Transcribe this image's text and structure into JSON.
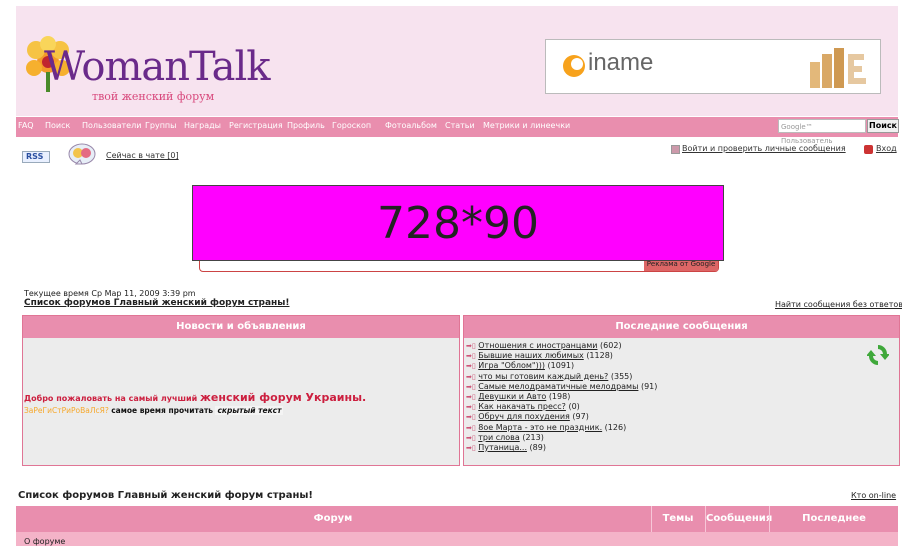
{
  "header": {
    "logo_title": "WomanTalk",
    "logo_subtitle": "твой женский форум",
    "partner_banner": "iname"
  },
  "nav": {
    "items": [
      "FAQ",
      "Поиск",
      "Пользователи",
      "Группы",
      "Награды",
      "Регистрация",
      "Профиль",
      "Гороскоп",
      "Фотоальбом",
      "Статьи",
      "Метрики и линеечки"
    ],
    "search_placeholder": "Google™ Пользователь",
    "search_button": "Поиск"
  },
  "toolbar": {
    "rss": "RSS",
    "chat": "Сейчас в чате [0]",
    "login": "Войти и проверить личные сообщения",
    "enter": "Вход"
  },
  "ad": {
    "placeholder_text": "728*90",
    "search_tag": "Реклама от Google"
  },
  "status": {
    "current_time": "Текущее время Ср Мар 11, 2009 3:39 pm",
    "forum_index": "Список форумов Главный женский форум страны!",
    "unanswered": "Найти сообщения без ответов"
  },
  "news_panel": {
    "title": "Новости и объявления",
    "welcome_prefix": "Добро пожаловать на самый лучший",
    "welcome_highlight": "женский форум Украины.",
    "registered": "ЗаРеГиСтРиРоВаЛсЯ?",
    "read_time": "самое время прочитать",
    "hidden_text": "скрытый текст"
  },
  "latest_panel": {
    "title": "Последние сообщения",
    "items": [
      {
        "title": "Отношения с иностранцами",
        "count": "(602)"
      },
      {
        "title": "Бывшие наших любимых",
        "count": "(1128)"
      },
      {
        "title": "Игра \"Облом\")))",
        "count": "(1091)"
      },
      {
        "title": "что мы готовим каждый день?",
        "count": "(355)"
      },
      {
        "title": "Самые мелодраматичные мелодрамы",
        "count": "(91)"
      },
      {
        "title": "Девушки и Авто",
        "count": "(198)"
      },
      {
        "title": "Как накачать пресс?",
        "count": "(0)"
      },
      {
        "title": "Обруч для похудения",
        "count": "(97)"
      },
      {
        "title": "8ое Марта - это не праздник.",
        "count": "(126)"
      },
      {
        "title": "три слова",
        "count": "(213)"
      },
      {
        "title": "Путаница...",
        "count": "(89)"
      }
    ]
  },
  "forum_table": {
    "title": "Список форумов Главный женский форум страны!",
    "online": "Кто on-line",
    "col_forum": "Форум",
    "col_topics": "Темы",
    "col_posts": "Сообщения",
    "col_last": "Последнее сообщение",
    "first_category": "О форуме"
  }
}
